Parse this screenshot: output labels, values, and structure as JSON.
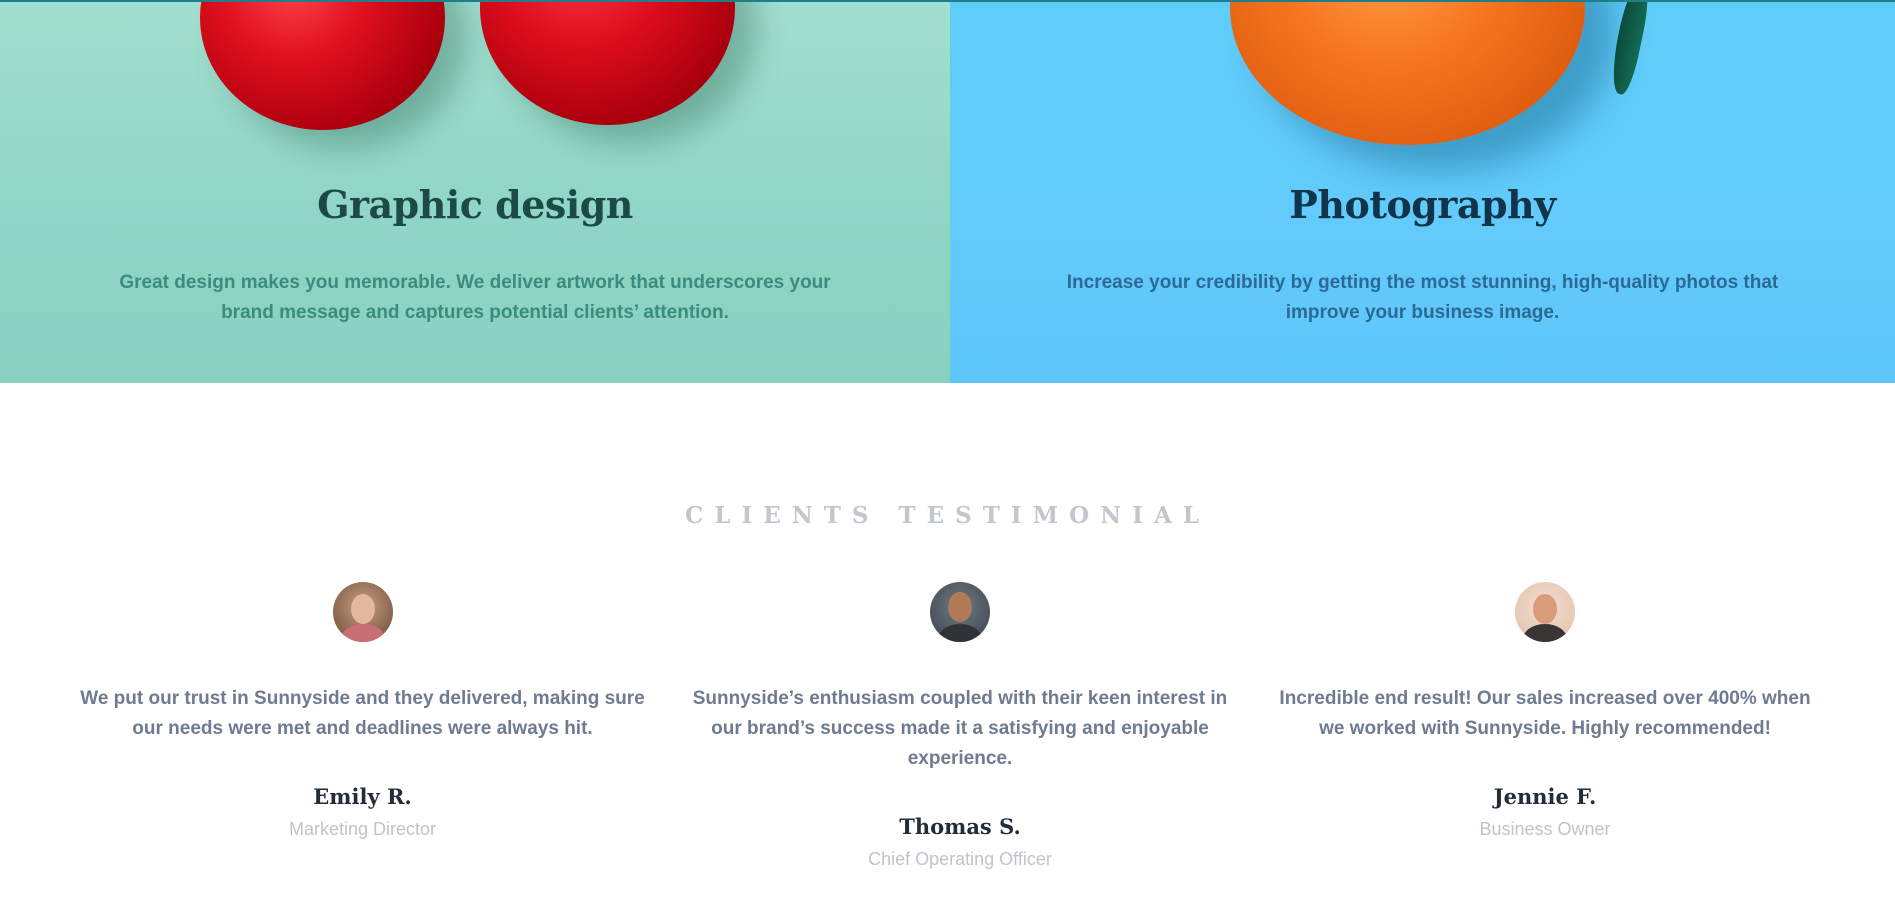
{
  "services": [
    {
      "title": "Graphic design",
      "text": "Great design makes you memorable. We deliver artwork that underscores your brand message and captures potential clients’ attention."
    },
    {
      "title": "Photography",
      "text": "Increase your credibility by getting the most stunning, high-quality photos that improve your business image."
    }
  ],
  "testimonials": {
    "title": "CLIENTS TESTIMONIAL",
    "items": [
      {
        "quote": "We put our trust in Sunnyside and they delivered, making sure our needs were met and deadlines were always hit.",
        "name": "Emily R.",
        "role": "Marketing Director"
      },
      {
        "quote": "Sunnyside’s enthusiasm coupled with their keen interest in our brand’s success made it a satisfying and enjoyable experience.",
        "name": "Thomas S.",
        "role": "Chief Operating Officer"
      },
      {
        "quote": "Incredible end result! Our sales increased over 400% when we worked with Sunnyside. Highly recommended!",
        "name": "Jennie F.",
        "role": "Business Owner"
      }
    ]
  },
  "colors": {
    "graphic_background": "#90d5c5",
    "photography_background": "#62cbfb",
    "heading_dark": "#232d3a",
    "quote_text": "#6f7b91",
    "muted_text": "#bfc3cb"
  }
}
